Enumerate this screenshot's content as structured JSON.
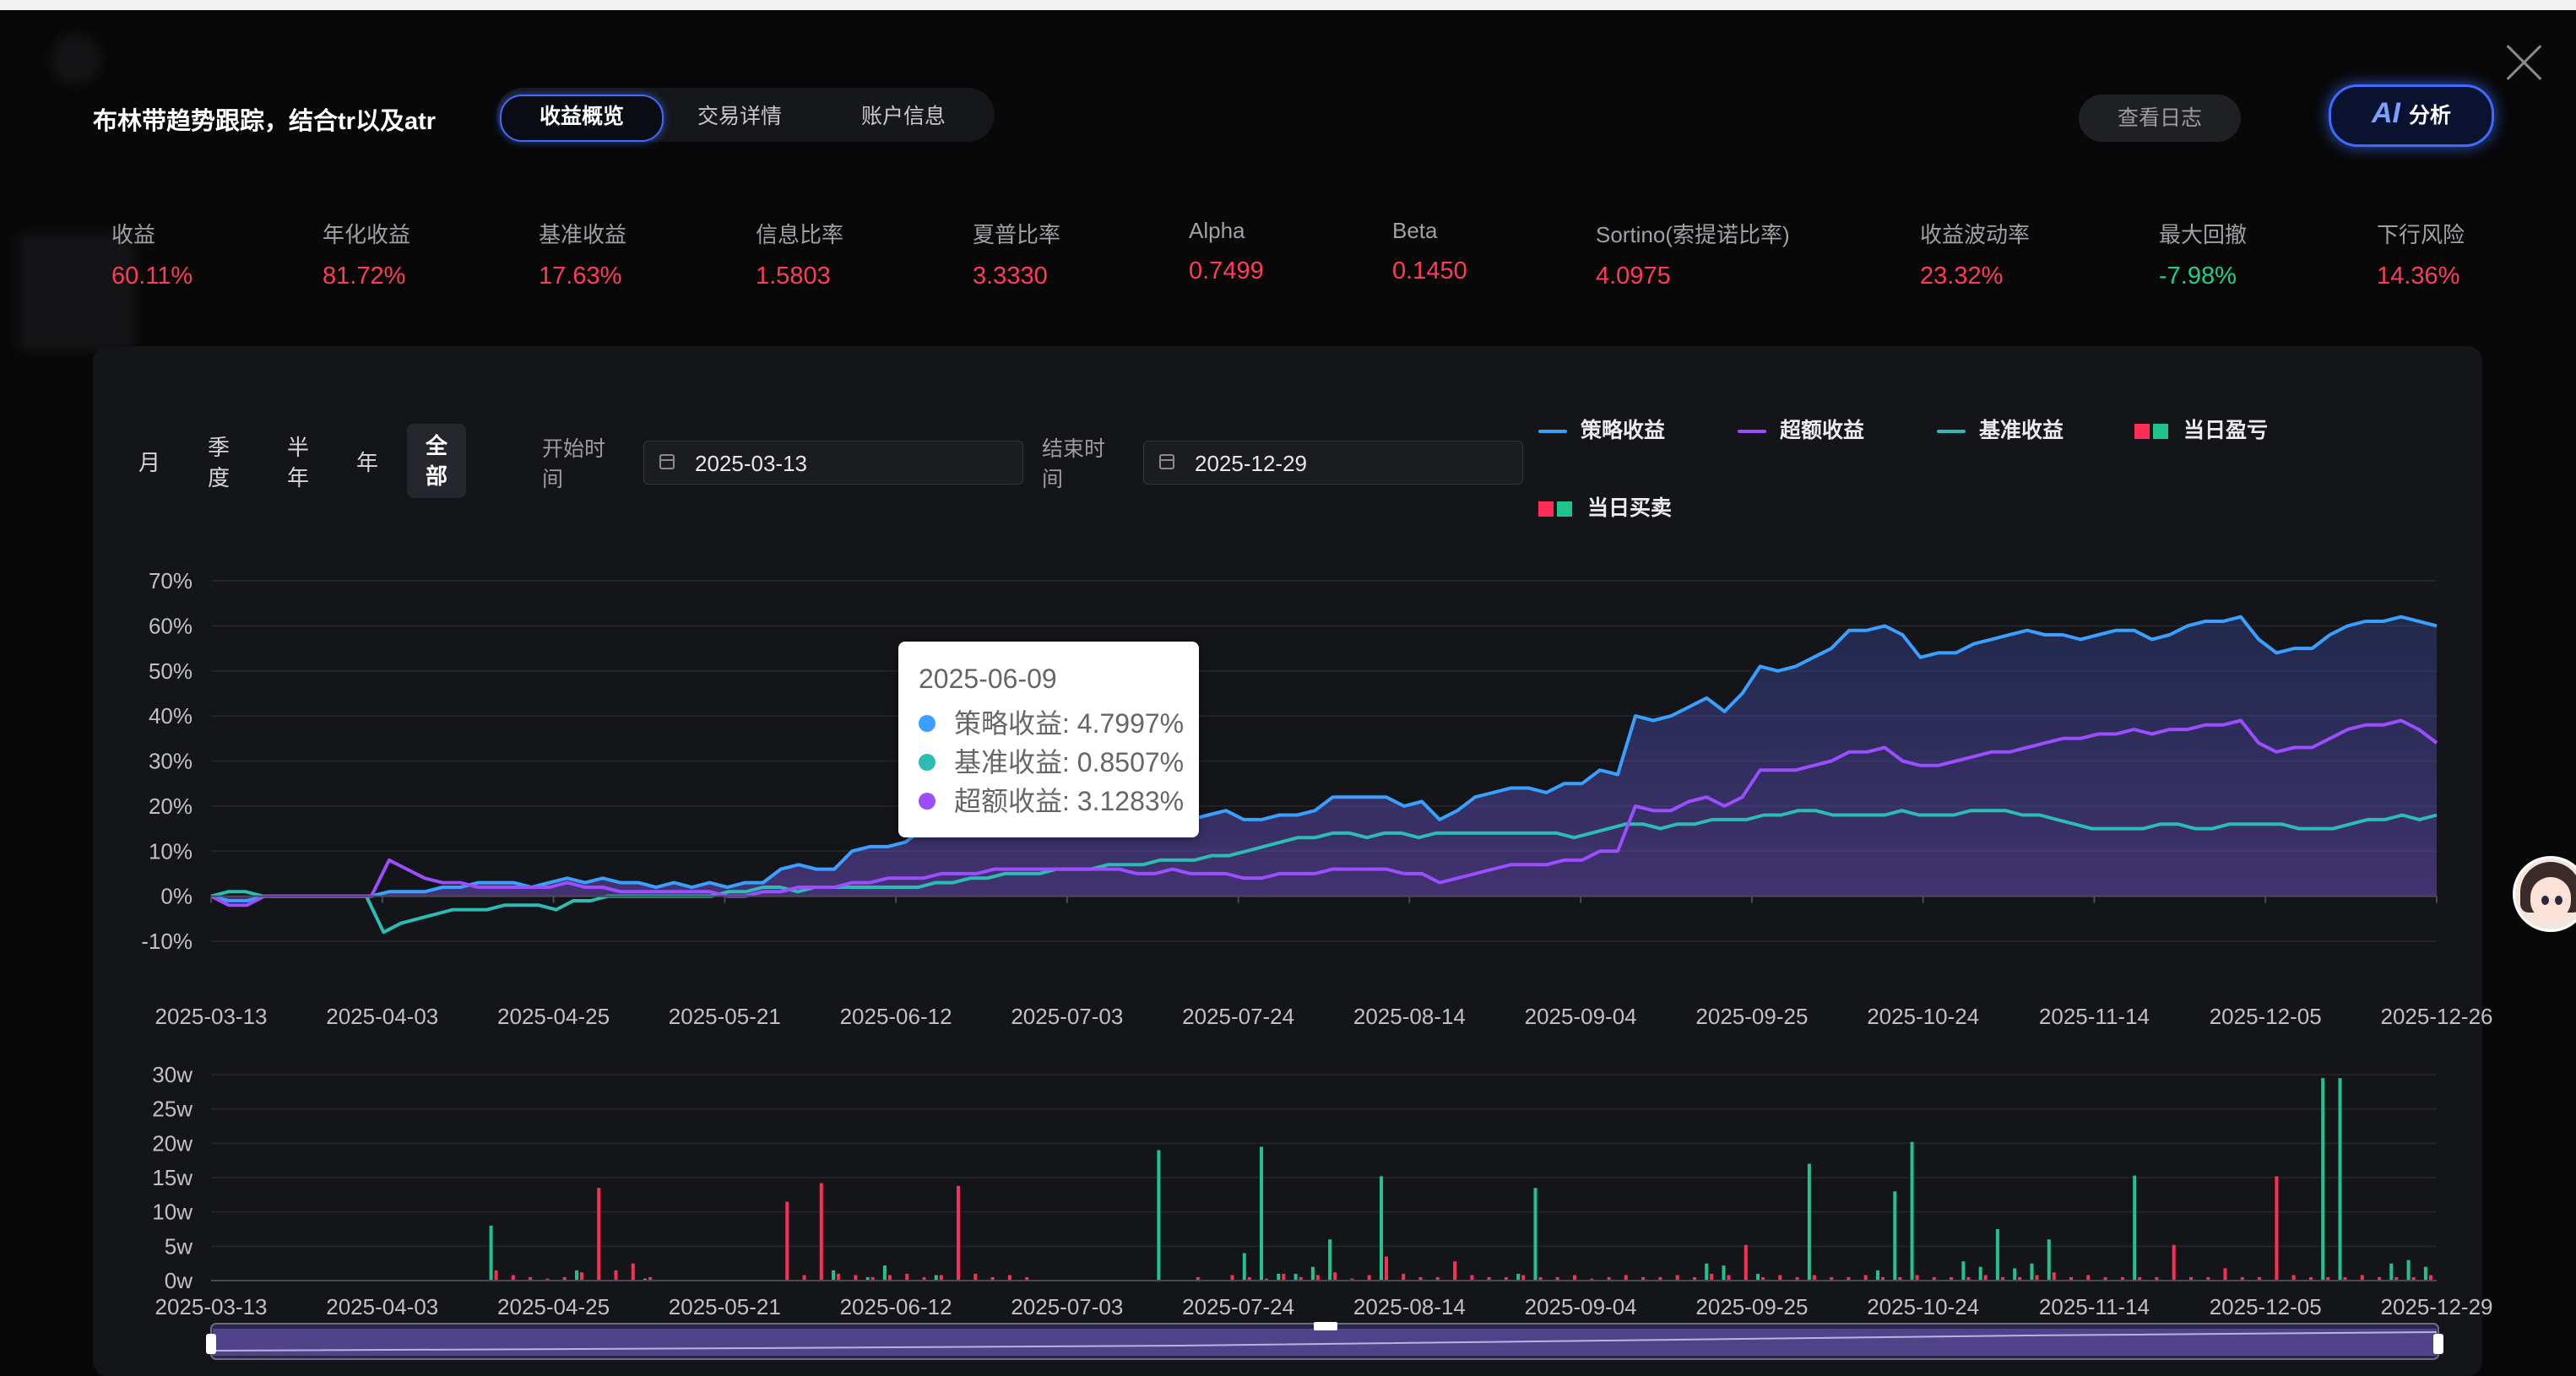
{
  "header": {
    "title": "布林带趋势跟踪，结合tr以及atr",
    "tabs": [
      "收益概览",
      "交易详情",
      "账户信息"
    ],
    "active_tab": 0,
    "log_button": "查看日志",
    "ai_button": {
      "ai": "AI",
      "label": "分析"
    }
  },
  "metrics": [
    {
      "label": "收益",
      "value": "60.11%",
      "color": "#ff3b5c"
    },
    {
      "label": "年化收益",
      "value": "81.72%",
      "color": "#ff3b5c"
    },
    {
      "label": "基准收益",
      "value": "17.63%",
      "color": "#ff3b5c"
    },
    {
      "label": "信息比率",
      "value": "1.5803",
      "color": "#ff3b5c"
    },
    {
      "label": "夏普比率",
      "value": "3.3330",
      "color": "#ff3b5c"
    },
    {
      "label": "Alpha",
      "value": "0.7499",
      "color": "#ff3b5c"
    },
    {
      "label": "Beta",
      "value": "0.1450",
      "color": "#ff3b5c"
    },
    {
      "label": "Sortino(索提诺比率)",
      "value": "4.0975",
      "color": "#ff3b5c"
    },
    {
      "label": "收益波动率",
      "value": "23.32%",
      "color": "#ff3b5c"
    },
    {
      "label": "最大回撤",
      "value": "-7.98%",
      "color": "#1fd08a"
    },
    {
      "label": "下行风险",
      "value": "14.36%",
      "color": "#ff3b5c"
    }
  ],
  "controls": {
    "periods": [
      {
        "top": "月",
        "bottom": ""
      },
      {
        "top": "季",
        "bottom": "度"
      },
      {
        "top": "半",
        "bottom": "年"
      },
      {
        "top": "年",
        "bottom": ""
      },
      {
        "top": "全",
        "bottom": "部"
      }
    ],
    "selected_period": 4,
    "start_label": {
      "l1": "开始时",
      "l2": "间"
    },
    "start_date": "2025-03-13",
    "end_label": {
      "l1": "结束时",
      "l2": "间"
    },
    "end_date": "2025-12-29"
  },
  "legend": [
    {
      "label": "策略收益",
      "type": "line",
      "color": "#3aa0ff"
    },
    {
      "label": "超额收益",
      "type": "line",
      "color": "#9b4dff"
    },
    {
      "label": "基准收益",
      "type": "line",
      "color": "#2bbcb4"
    },
    {
      "label": "当日盈亏",
      "type": "squares",
      "colors": [
        "#ff2d55",
        "#1fc48a"
      ]
    },
    {
      "label": "当日买卖",
      "type": "squares",
      "colors": [
        "#ff2d55",
        "#1fc48a"
      ]
    }
  ],
  "tooltip": {
    "date": "2025-06-09",
    "rows": [
      {
        "label": "策略收益",
        "value": "4.7997%",
        "color": "#3aa0ff"
      },
      {
        "label": "基准收益",
        "value": "0.8507%",
        "color": "#2bbcb4"
      },
      {
        "label": "超额收益",
        "value": "3.1283%",
        "color": "#9b4dff"
      }
    ]
  },
  "chart_data": [
    {
      "type": "line",
      "title": "",
      "x_ticks": [
        "2025-03-13",
        "2025-04-03",
        "2025-04-25",
        "2025-05-21",
        "2025-06-12",
        "2025-07-03",
        "2025-07-24",
        "2025-08-14",
        "2025-09-04",
        "2025-09-25",
        "2025-10-24",
        "2025-11-14",
        "2025-12-05",
        "2025-12-26"
      ],
      "y_ticks": [
        "-10%",
        "0%",
        "10%",
        "20%",
        "30%",
        "40%",
        "50%",
        "60%",
        "70%"
      ],
      "ylim": [
        -10,
        70
      ],
      "grid": true,
      "legend": "top-right",
      "series": [
        {
          "name": "策略收益",
          "color": "#3aa0ff",
          "values": [
            0,
            -1,
            -1,
            0,
            0,
            0,
            0,
            0,
            0,
            0,
            1,
            1,
            1,
            2,
            2,
            3,
            3,
            3,
            2,
            3,
            4,
            3,
            4,
            3,
            3,
            2,
            3,
            2,
            3,
            2,
            3,
            3,
            6,
            7,
            6,
            6,
            10,
            11,
            11,
            12,
            15,
            20,
            21,
            22,
            23,
            21,
            20,
            15,
            14,
            14,
            15,
            15,
            17,
            18,
            18,
            17,
            18,
            19,
            17,
            17,
            18,
            18,
            19,
            22,
            22,
            22,
            22,
            20,
            21,
            17,
            19,
            22,
            23,
            24,
            24,
            23,
            25,
            25,
            28,
            27,
            40,
            39,
            40,
            42,
            44,
            41,
            45,
            51,
            50,
            51,
            53,
            55,
            59,
            59,
            60,
            58,
            53,
            54,
            54,
            56,
            57,
            58,
            59,
            58,
            58,
            57,
            58,
            59,
            59,
            57,
            58,
            60,
            61,
            61,
            62,
            57,
            54,
            55,
            55,
            58,
            60,
            61,
            61,
            62,
            61,
            60
          ]
        },
        {
          "name": "基准收益",
          "color": "#2bbcb4",
          "values": [
            0,
            1,
            1,
            0,
            0,
            0,
            0,
            0,
            0,
            0,
            -8,
            -6,
            -5,
            -4,
            -3,
            -3,
            -3,
            -2,
            -2,
            -2,
            -3,
            -1,
            -1,
            0,
            0,
            0,
            0,
            0,
            0,
            0,
            1,
            1,
            2,
            2,
            1,
            2,
            2,
            2,
            2,
            2,
            2,
            2,
            3,
            3,
            4,
            4,
            5,
            5,
            5,
            6,
            6,
            6,
            7,
            7,
            7,
            8,
            8,
            8,
            9,
            9,
            10,
            11,
            12,
            13,
            13,
            14,
            14,
            13,
            14,
            14,
            13,
            14,
            14,
            14,
            14,
            14,
            14,
            14,
            14,
            13,
            14,
            15,
            16,
            16,
            15,
            16,
            16,
            17,
            17,
            17,
            18,
            18,
            19,
            19,
            18,
            18,
            18,
            18,
            19,
            18,
            18,
            18,
            19,
            19,
            19,
            18,
            18,
            17,
            16,
            15,
            15,
            15,
            15,
            16,
            16,
            15,
            15,
            16,
            16,
            16,
            16,
            15,
            15,
            15,
            16,
            17,
            17,
            18,
            17,
            18
          ]
        },
        {
          "name": "超额收益",
          "color": "#9b4dff",
          "values": [
            0,
            -2,
            -2,
            0,
            0,
            0,
            0,
            0,
            0,
            0,
            8,
            6,
            4,
            3,
            3,
            2,
            2,
            2,
            2,
            2,
            3,
            2,
            2,
            1,
            1,
            1,
            1,
            1,
            1,
            0,
            0,
            1,
            1,
            2,
            2,
            2,
            3,
            3,
            4,
            4,
            4,
            5,
            5,
            5,
            6,
            6,
            6,
            6,
            6,
            6,
            6,
            6,
            5,
            5,
            6,
            5,
            5,
            5,
            4,
            4,
            5,
            5,
            5,
            6,
            6,
            6,
            6,
            5,
            5,
            3,
            4,
            5,
            6,
            7,
            7,
            7,
            8,
            8,
            10,
            10,
            20,
            19,
            19,
            21,
            22,
            20,
            22,
            28,
            28,
            28,
            29,
            30,
            32,
            32,
            33,
            30,
            29,
            29,
            30,
            31,
            32,
            32,
            33,
            34,
            35,
            35,
            36,
            36,
            37,
            36,
            37,
            37,
            38,
            38,
            39,
            34,
            32,
            33,
            33,
            35,
            37,
            38,
            38,
            39,
            37,
            34
          ]
        }
      ]
    },
    {
      "type": "bar",
      "title": "",
      "x_ticks": [
        "2025-03-13",
        "2025-04-03",
        "2025-04-25",
        "2025-05-21",
        "2025-06-12",
        "2025-07-03",
        "2025-07-24",
        "2025-08-14",
        "2025-09-04",
        "2025-09-25",
        "2025-10-24",
        "2025-11-14",
        "2025-12-05",
        "2025-12-29"
      ],
      "y_ticks": [
        "0w",
        "5w",
        "10w",
        "15w",
        "20w",
        "25w",
        "30w"
      ],
      "ylim": [
        0,
        30
      ],
      "grid": true,
      "series": [
        {
          "name": "当日盈亏",
          "color": "#ff2d55",
          "values": [
            0,
            0,
            0,
            0,
            0,
            0,
            0,
            0,
            0,
            0,
            0,
            0,
            0,
            0,
            0,
            0,
            1.5,
            0.8,
            0.5,
            0.3,
            0.5,
            1.2,
            13.5,
            1.5,
            2.5,
            0.5,
            0,
            0,
            0,
            0,
            0,
            0,
            0,
            11.5,
            0.8,
            14.2,
            1.0,
            0.8,
            0.5,
            0.8,
            1.0,
            0.5,
            0.8,
            13.8,
            1.0,
            0.5,
            0.8,
            0.5,
            0,
            0,
            0,
            0,
            0,
            0,
            0,
            0,
            0,
            0.5,
            0,
            0.8,
            0.5,
            0.3,
            1.0,
            0.5,
            0.8,
            1.2,
            0.3,
            0.8,
            3.5,
            1.0,
            0.5,
            0.5,
            2.8,
            0.8,
            0.5,
            0.5,
            0.8,
            0.5,
            0.5,
            0.8,
            0.3,
            0.5,
            0.8,
            0.5,
            0.5,
            0.8,
            0.5,
            1.0,
            0.8,
            5.2,
            0.5,
            0.8,
            0.5,
            0.8,
            0.5,
            0.5,
            0.8,
            0.5,
            0.5,
            0.8,
            0.5,
            0.5,
            0.5,
            0.8,
            0.5,
            0.5,
            0.8,
            1.2,
            0.5,
            0.8,
            0.5,
            0.5,
            0.5,
            0.5,
            5.2,
            0.5,
            0.5,
            1.8,
            0.5,
            0.5,
            15.2,
            0.8,
            0.5,
            0.5,
            0.5,
            0.8,
            0.5,
            0.5,
            0.5,
            0.8
          ]
        },
        {
          "name": "当日买卖",
          "color": "#1fc48a",
          "values": [
            0,
            0,
            0,
            0,
            0,
            0,
            0,
            0,
            0,
            0,
            0,
            0,
            0,
            0,
            0,
            0,
            8,
            0,
            0,
            0,
            0,
            1.5,
            0,
            0,
            0,
            0.3,
            0,
            0,
            0,
            0,
            0,
            0,
            0,
            0,
            0,
            0,
            1.5,
            0,
            0.5,
            2.2,
            0,
            0,
            0.8,
            0,
            0,
            0,
            0,
            0,
            0,
            0,
            0,
            0,
            0,
            0,
            0,
            19,
            0,
            0,
            0,
            0,
            4,
            19.5,
            1.0,
            1.0,
            2.0,
            6.0,
            0,
            0,
            15.2,
            0,
            0,
            0,
            0,
            0,
            0,
            0,
            1.0,
            13.5,
            0,
            0,
            0,
            0,
            0,
            0,
            0,
            0,
            0,
            2.5,
            2.2,
            0,
            1.0,
            0,
            0,
            17,
            0,
            0,
            0,
            1.5,
            13,
            20.2,
            0,
            0,
            2.8,
            2.0,
            7.5,
            1.8,
            2.5,
            6.0,
            0,
            0,
            0,
            0,
            15.3,
            0,
            0,
            0,
            0,
            0,
            0,
            0,
            0,
            0,
            0,
            29.5,
            29.5,
            0,
            0,
            2.5,
            3.0,
            2.0,
            0,
            0.5,
            1.5,
            0.5,
            0.5,
            0
          ]
        }
      ]
    }
  ]
}
